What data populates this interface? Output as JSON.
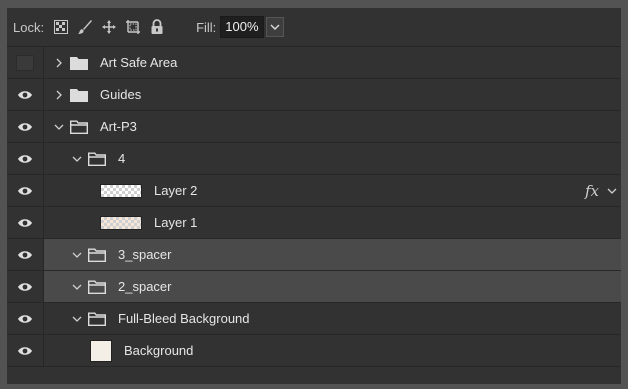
{
  "lock": {
    "label": "Lock:"
  },
  "fill": {
    "label": "Fill:",
    "value": "100%"
  },
  "layers": [
    {
      "name": "Art Safe Area",
      "kind": "group",
      "visible": false,
      "expanded": false,
      "indent": 0,
      "selected": false
    },
    {
      "name": "Guides",
      "kind": "group",
      "visible": true,
      "expanded": false,
      "indent": 0,
      "selected": false
    },
    {
      "name": "Art-P3",
      "kind": "group",
      "visible": true,
      "expanded": true,
      "indent": 0,
      "selected": false
    },
    {
      "name": "4",
      "kind": "group",
      "visible": true,
      "expanded": true,
      "indent": 1,
      "selected": false
    },
    {
      "name": "Layer 2",
      "kind": "layer",
      "visible": true,
      "indent": 2,
      "selected": false,
      "fx": "fx"
    },
    {
      "name": "Layer 1",
      "kind": "layer",
      "visible": true,
      "indent": 2,
      "selected": false
    },
    {
      "name": "3_spacer",
      "kind": "group",
      "visible": true,
      "expanded": true,
      "indent": 1,
      "selected": true
    },
    {
      "name": "2_spacer",
      "kind": "group",
      "visible": true,
      "expanded": true,
      "indent": 1,
      "selected": true
    },
    {
      "name": "Full-Bleed Background",
      "kind": "group",
      "visible": true,
      "expanded": true,
      "indent": 1,
      "selected": false
    },
    {
      "name": "Background",
      "kind": "background",
      "visible": true,
      "indent": 1,
      "selected": false
    }
  ]
}
